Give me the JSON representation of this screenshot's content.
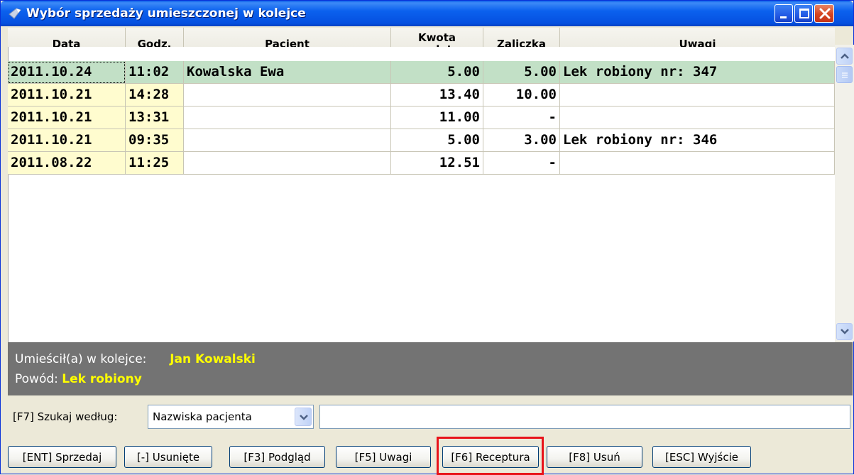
{
  "window": {
    "title": "Wybór sprzedaży umieszczonej w kolejce"
  },
  "table": {
    "headers": {
      "date": "Data",
      "time": "Godz.",
      "patient": "Pacjent",
      "amount_line1": "Kwota",
      "amount_line2": "zapłaty",
      "advance": "Zaliczka",
      "notes": "Uwagi"
    },
    "rows": [
      {
        "date": "2011.10.24",
        "time": "11:02",
        "patient": "Kowalska Ewa",
        "amount": "5.00",
        "advance": "5.00",
        "notes": "Lek robiony nr: 347"
      },
      {
        "date": "2011.10.21",
        "time": "14:28",
        "patient": "",
        "amount": "13.40",
        "advance": "10.00",
        "notes": ""
      },
      {
        "date": "2011.10.21",
        "time": "13:31",
        "patient": "",
        "amount": "11.00",
        "advance": "-",
        "notes": ""
      },
      {
        "date": "2011.10.21",
        "time": "09:35",
        "patient": "",
        "amount": "5.00",
        "advance": "3.00",
        "notes": "Lek robiony nr: 346"
      },
      {
        "date": "2011.08.22",
        "time": "11:25",
        "patient": "",
        "amount": "12.51",
        "advance": "-",
        "notes": ""
      }
    ]
  },
  "info": {
    "placed_label": "Umieścił(a) w kolejce:",
    "placed_value": "Jan Kowalski",
    "reason_label": "Powód:",
    "reason_value": "Lek robiony"
  },
  "search": {
    "label": "[F7] Szukaj według:",
    "select_value": "Nazwiska pacjenta",
    "input_value": ""
  },
  "buttons": {
    "sell": "[ENT] Sprzedaj",
    "removed": "[-] Usunięte",
    "preview": "[F3] Podgląd",
    "notes": "[F5] Uwagi",
    "prescription": "[F6] Receptura",
    "delete": "[F8] Usuń",
    "exit": "[ESC] Wyjście"
  },
  "colors": {
    "titlebar": "#0b61ee",
    "selected_row": "#c2e0c6",
    "date_cell": "#fffccf",
    "info_panel": "#737373",
    "info_value": "#ffff00",
    "highlight": "#e8141a"
  }
}
